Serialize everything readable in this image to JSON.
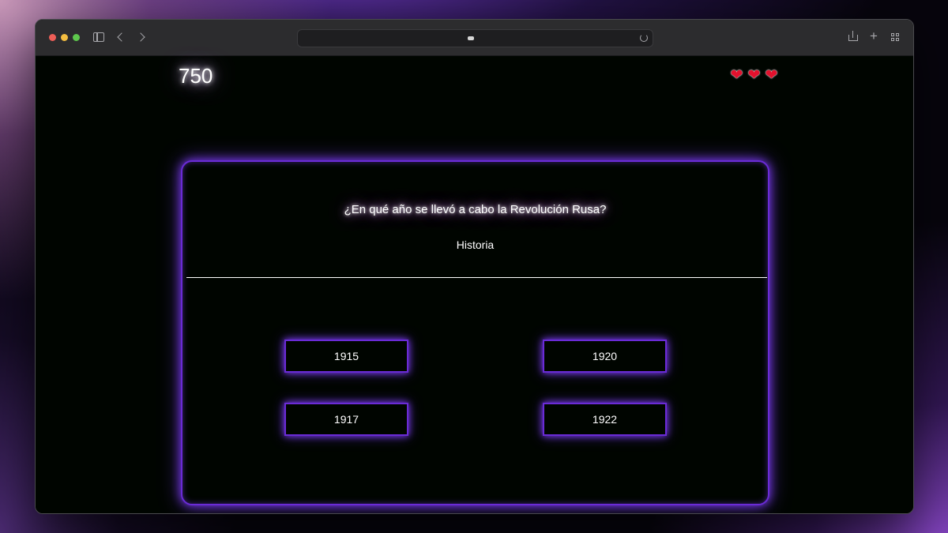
{
  "browser": {
    "toolbar_icons": [
      "sidebar-icon",
      "back-chevron-icon",
      "forward-chevron-icon",
      "reload-icon",
      "share-icon",
      "new-tab-plus-icon",
      "tab-overview-icon"
    ],
    "plus_glyph": "+"
  },
  "game": {
    "score": "750",
    "lives": {
      "count": 3,
      "glyph": "❤",
      "color": "#e2112d"
    },
    "question": "¿En qué año se llevó a cabo la Revolución Rusa?",
    "category": "Historia",
    "options": [
      {
        "label": "1915"
      },
      {
        "label": "1920"
      },
      {
        "label": "1917"
      },
      {
        "label": "1922"
      }
    ],
    "accent_color": "#6a2bd6"
  }
}
